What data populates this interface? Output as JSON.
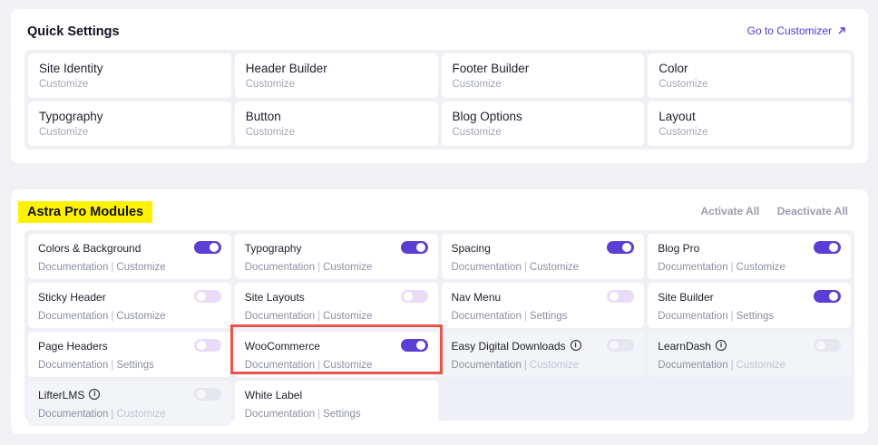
{
  "quick_settings": {
    "title": "Quick Settings",
    "link": "Go to Customizer",
    "items": [
      {
        "name": "Site Identity",
        "sub": "Customize"
      },
      {
        "name": "Header Builder",
        "sub": "Customize"
      },
      {
        "name": "Footer Builder",
        "sub": "Customize"
      },
      {
        "name": "Color",
        "sub": "Customize"
      },
      {
        "name": "Typography",
        "sub": "Customize"
      },
      {
        "name": "Button",
        "sub": "Customize"
      },
      {
        "name": "Blog Options",
        "sub": "Customize"
      },
      {
        "name": "Layout",
        "sub": "Customize"
      }
    ]
  },
  "pro_modules": {
    "title": "Astra Pro Modules",
    "activate_all": "Activate All",
    "deactivate_all": "Deactivate All",
    "separator": "|",
    "accent_color": "#5b3fd4",
    "modules": [
      {
        "name": "Colors & Background",
        "link1": "Documentation",
        "link2": "Customize",
        "state": "on"
      },
      {
        "name": "Typography",
        "link1": "Documentation",
        "link2": "Customize",
        "state": "on"
      },
      {
        "name": "Spacing",
        "link1": "Documentation",
        "link2": "Customize",
        "state": "on"
      },
      {
        "name": "Blog Pro",
        "link1": "Documentation",
        "link2": "Customize",
        "state": "on"
      },
      {
        "name": "Sticky Header",
        "link1": "Documentation",
        "link2": "Customize",
        "state": "off"
      },
      {
        "name": "Site Layouts",
        "link1": "Documentation",
        "link2": "Customize",
        "state": "off"
      },
      {
        "name": "Nav Menu",
        "link1": "Documentation",
        "link2": "Settings",
        "state": "off"
      },
      {
        "name": "Site Builder",
        "link1": "Documentation",
        "link2": "Settings",
        "state": "on"
      },
      {
        "name": "Page Headers",
        "link1": "Documentation",
        "link2": "Settings",
        "state": "off"
      },
      {
        "name": "WooCommerce",
        "link1": "Documentation",
        "link2": "Customize",
        "state": "on"
      },
      {
        "name": "Easy Digital Downloads",
        "link1": "Documentation",
        "link2": "Customize",
        "state": "disabled"
      },
      {
        "name": "LearnDash",
        "link1": "Documentation",
        "link2": "Customize",
        "state": "disabled"
      },
      {
        "name": "LifterLMS",
        "link1": "Documentation",
        "link2": "Customize",
        "state": "disabled"
      },
      {
        "name": "White Label",
        "link1": "Documentation",
        "link2": "Settings",
        "state": "none"
      }
    ]
  }
}
